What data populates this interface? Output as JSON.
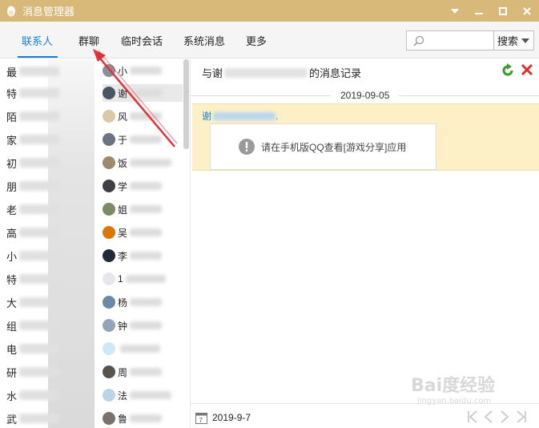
{
  "window": {
    "title": "消息管理器"
  },
  "menu": {
    "tabs": [
      "联系人",
      "群聊",
      "临时会话",
      "系统消息",
      "更多"
    ],
    "active_tab": "联系人",
    "search_placeholder": "",
    "search_button": "搜索"
  },
  "categories": [
    "最",
    "特",
    "陌",
    "家",
    "初",
    "朋",
    "老",
    "高",
    "小",
    "特",
    "大",
    "组",
    "电",
    "研",
    "水",
    "武"
  ],
  "contacts": [
    "小",
    "谢",
    "风",
    "于",
    "饭",
    "学",
    "姐",
    "吴",
    "李",
    "1",
    "杨",
    "钟",
    "",
    "周",
    "法",
    "鲁"
  ],
  "record": {
    "title_prefix": "与谢",
    "title_suffix": "的消息记录",
    "date": "2019-09-05",
    "sender_prefix": "谢",
    "sender_suffix": ".",
    "message": "请在手机版QQ查看[游戏分享]应用"
  },
  "footer": {
    "date": "2019-9-7"
  },
  "watermark": {
    "line1": "Bai度经验",
    "line2": "jingyan.baidu.com"
  },
  "colors": {
    "titlebar": "#d8b97a",
    "accent": "#1a7fd0",
    "message_bg": "#fdf0c6",
    "annotation": "#e0303a"
  }
}
